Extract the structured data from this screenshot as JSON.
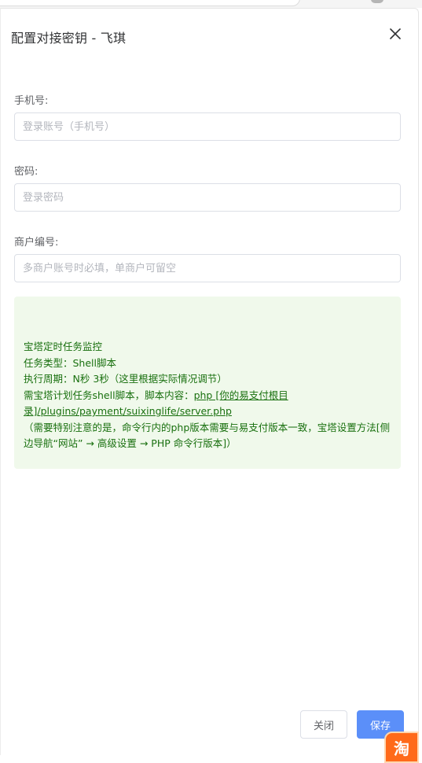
{
  "dialog": {
    "title": "配置对接密钥 - 飞琪",
    "close_icon": "close-icon"
  },
  "form": {
    "phone": {
      "label": "手机号:",
      "placeholder": "登录账号（手机号）",
      "value": ""
    },
    "password": {
      "label": "密码:",
      "placeholder": "登录密码",
      "value": ""
    },
    "merchant": {
      "label": "商户编号:",
      "placeholder": "多商户账号时必填，单商户可留空",
      "value": ""
    }
  },
  "notice": {
    "line1": "宝塔定时任务监控",
    "line2": "任务类型：Shell脚本",
    "line3": "执行周期：N秒 3秒（这里根据实际情况调节）",
    "line4_prefix": "需宝塔计划任务shell脚本，脚本内容：",
    "line4_link": "php [你的易支付根目录]/plugins/payment/suixinglife/server.php",
    "line5": "（需要特别注意的是，命令行内的php版本需要与易支付版本一致，宝塔设置方法[侧边导航“网站” → 高级设置 → PHP 命令行版本]）",
    "bg_color": "#f0f9eb",
    "text_color": "#19700f"
  },
  "footer": {
    "close_label": "关闭",
    "save_label": "保存",
    "save_color": "#5b8ff9"
  },
  "corner_badge": {
    "text": "淘"
  }
}
